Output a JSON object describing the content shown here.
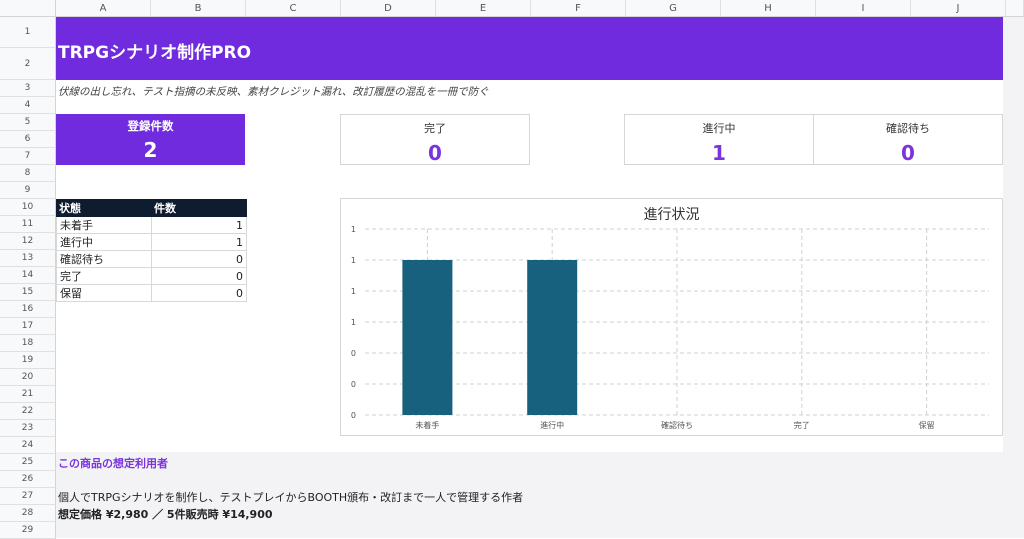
{
  "columns": [
    "A",
    "B",
    "C",
    "D",
    "E",
    "F",
    "G",
    "H",
    "I",
    "J"
  ],
  "rows": [
    "1",
    "2",
    "3",
    "4",
    "5",
    "6",
    "7",
    "8",
    "9",
    "10",
    "11",
    "12",
    "13",
    "14",
    "15",
    "16",
    "17",
    "18",
    "19",
    "20",
    "21",
    "22",
    "23",
    "24",
    "25",
    "26",
    "27",
    "28",
    "29"
  ],
  "header": {
    "title": "TRPGシナリオ制作PRO",
    "subtitle": "伏線の出し忘れ、テスト指摘の未反映、素材クレジット漏れ、改訂履歴の混乱を一冊で防ぐ"
  },
  "kpis": {
    "registered": {
      "label": "登録件数",
      "value": "2"
    },
    "done": {
      "label": "完了",
      "value": "0"
    },
    "in_progress": {
      "label": "進行中",
      "value": "1"
    },
    "awaiting": {
      "label": "確認待ち",
      "value": "0"
    }
  },
  "status_table": {
    "headers": [
      "状態",
      "件数"
    ],
    "rows": [
      {
        "state": "未着手",
        "count": "1"
      },
      {
        "state": "進行中",
        "count": "1"
      },
      {
        "state": "確認待ち",
        "count": "0"
      },
      {
        "state": "完了",
        "count": "0"
      },
      {
        "state": "保留",
        "count": "0"
      }
    ]
  },
  "chart_data": {
    "type": "bar",
    "title": "進行状況",
    "categories": [
      "未着手",
      "進行中",
      "確認待ち",
      "完了",
      "保留"
    ],
    "values": [
      1,
      1,
      0,
      0,
      0
    ],
    "y_tick_labels": [
      "1",
      "1",
      "1",
      "1",
      "0",
      "0",
      "0"
    ],
    "ylim": [
      0,
      1.2
    ],
    "grid": true,
    "bar_color": "#17607e"
  },
  "footer": {
    "section_title": "この商品の想定利用者",
    "description": "個人でTRPGシナリオを制作し、テストプレイからBOOTH頒布・改訂まで一人で管理する作者",
    "price": "想定価格 ¥2,980 ／ 5件販売時 ¥14,900"
  },
  "colors": {
    "accent": "#6f2bdd",
    "kpi_value": "#7a33dd",
    "table_header": "#0f1b2e"
  }
}
